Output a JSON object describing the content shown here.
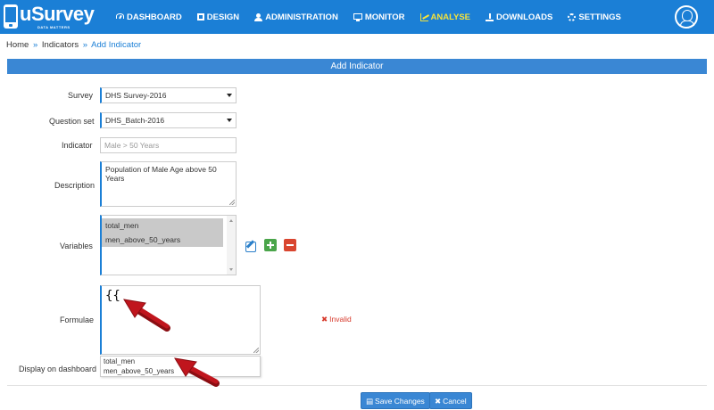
{
  "brand": {
    "name": "uSurvey",
    "tagline": "DATA MATTERS"
  },
  "nav": {
    "items": [
      {
        "label": "DASHBOARD",
        "icon": "dashboard-icon",
        "active": false
      },
      {
        "label": "DESIGN",
        "icon": "design-icon",
        "active": false
      },
      {
        "label": "ADMINISTRATION",
        "icon": "user-icon",
        "active": false
      },
      {
        "label": "MONITOR",
        "icon": "monitor-icon",
        "active": false
      },
      {
        "label": "ANALYSE",
        "icon": "chart-icon",
        "active": true
      },
      {
        "label": "DOWNLOADS",
        "icon": "download-icon",
        "active": false
      },
      {
        "label": "SETTINGS",
        "icon": "gear-icon",
        "active": false
      }
    ],
    "active_color": "#f5e23a",
    "bar_color": "#1b7fd6"
  },
  "breadcrumb": {
    "home": "Home",
    "indicators": "Indicators",
    "current": "Add Indicator",
    "separator": "»"
  },
  "panel": {
    "title": "Add Indicator"
  },
  "form": {
    "survey": {
      "label": "Survey",
      "value": "DHS Survey-2016"
    },
    "question_set": {
      "label": "Question set",
      "value": "DHS_Batch-2016"
    },
    "indicator": {
      "label": "Indicator",
      "placeholder": "Male > 50 Years"
    },
    "description": {
      "label": "Description",
      "value": "Population of Male Age above 50 Years"
    },
    "variables": {
      "label": "Variables",
      "options": [
        "total_men",
        "men_above_50_years"
      ]
    },
    "formulae": {
      "label": "Formulae",
      "value": "{{",
      "status": "Invalid"
    },
    "display_on_dashboard": {
      "label": "Display on dashboard"
    },
    "suggestions": [
      "total_men",
      "men_above_50_years"
    ]
  },
  "actions": {
    "save": "Save Changes",
    "cancel": "Cancel"
  },
  "colors": {
    "primary": "#3a87d4",
    "error": "#d73a2c",
    "add": "#4aa54a",
    "remove": "#d9452f",
    "annotation_arrow": "#b5121b"
  }
}
